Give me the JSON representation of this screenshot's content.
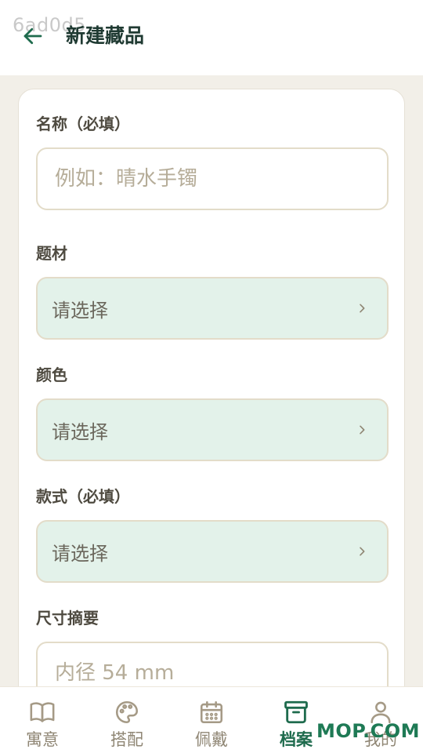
{
  "header": {
    "watermark": "6ad0d5",
    "title": "新建藏品"
  },
  "form": {
    "name": {
      "label": "名称（必填）",
      "placeholder": "例如：晴水手镯"
    },
    "theme": {
      "label": "题材",
      "value": "请选择"
    },
    "color": {
      "label": "颜色",
      "value": "请选择"
    },
    "style": {
      "label": "款式（必填）",
      "value": "请选择"
    },
    "size": {
      "label": "尺寸摘要",
      "placeholder": "内径 54 mm"
    }
  },
  "tabbar": {
    "items": [
      {
        "label": "寓意",
        "icon": "book-icon"
      },
      {
        "label": "搭配",
        "icon": "palette-icon"
      },
      {
        "label": "佩戴",
        "icon": "calendar-icon"
      },
      {
        "label": "档案",
        "icon": "archive-icon",
        "active": true
      },
      {
        "label": "我的",
        "icon": "user-icon"
      }
    ],
    "overlay_text": "MOP.COM"
  },
  "colors": {
    "accent": "#1e6b4d",
    "select_bg": "#e3f2ea",
    "page_bg": "#f2efe8"
  }
}
